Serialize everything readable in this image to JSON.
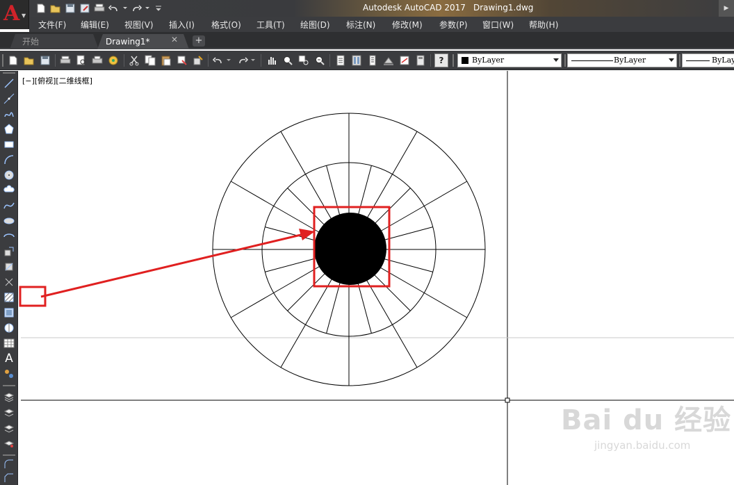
{
  "app": {
    "logo_letter": "A",
    "title": "Autodesk AutoCAD 2017",
    "document": "Drawing1.dwg",
    "accent_color": "#d1232a"
  },
  "menu": {
    "items": [
      "文件(F)",
      "编辑(E)",
      "视图(V)",
      "插入(I)",
      "格式(O)",
      "工具(T)",
      "绘图(D)",
      "标注(N)",
      "修改(M)",
      "参数(P)",
      "窗口(W)",
      "帮助(H)"
    ]
  },
  "tabs": {
    "start_label": "开始",
    "drawing_label": "Drawing1*",
    "close_glyph": "✕",
    "add_glyph": "+"
  },
  "properties": {
    "color_value": "ByLayer",
    "linetype_value": "ByLayer",
    "lineweight_value": "ByLay"
  },
  "canvas": {
    "viewport_label": "[−][俯视][二维线框]",
    "highlight_color": "#e02020"
  },
  "watermark": {
    "logo": "Bai du 经验",
    "url": "jingyan.baidu.com"
  }
}
